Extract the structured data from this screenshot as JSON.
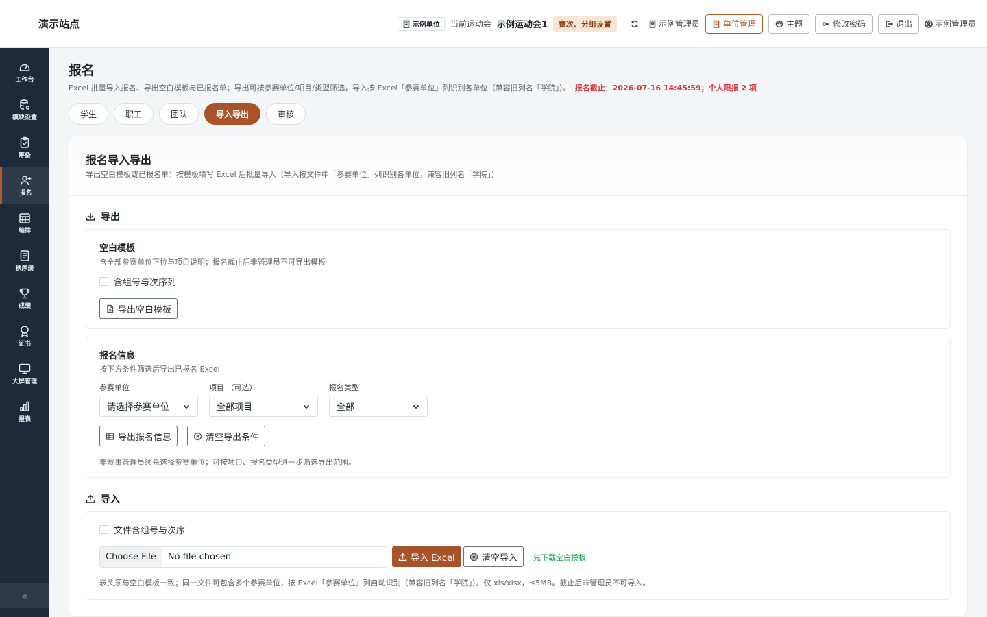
{
  "header": {
    "site_title": "演示站点",
    "unit_tag": "示例单位",
    "current_meet_label": "当前运动会",
    "current_meet": "示例运动会1",
    "round_group_tag": "赛次、分组设置",
    "admin_role": "示例管理员",
    "unit_manage": "单位管理",
    "theme": "主题",
    "change_password": "修改密码",
    "logout": "退出",
    "user": "示例管理员",
    "accent_color": "#b65a28"
  },
  "sidebar": {
    "items": [
      {
        "label": "工作台",
        "icon": "dashboard-icon"
      },
      {
        "label": "模块设置",
        "icon": "database-settings-icon"
      },
      {
        "label": "筹备",
        "icon": "clipboard-icon"
      },
      {
        "label": "报名",
        "icon": "user-add-icon"
      },
      {
        "label": "编排",
        "icon": "calendar-grid-icon"
      },
      {
        "label": "秩序册",
        "icon": "book-list-icon"
      },
      {
        "label": "成绩",
        "icon": "trophy-icon"
      },
      {
        "label": "证书",
        "icon": "award-icon"
      },
      {
        "label": "大屏管理",
        "icon": "monitor-icon"
      },
      {
        "label": "报表",
        "icon": "bar-chart-icon"
      }
    ],
    "active_index": 3,
    "collapse_glyph": "«"
  },
  "page": {
    "title": "报名",
    "description": "Excel 批量导入报名、导出空白模板与已报名单；导出可按参赛单位/项目/类型筛选，导入按 Excel「参赛单位」列识别各单位（兼容旧列名「学院」）。",
    "deadline": "报名截止：2026-07-16 14:45:59；个人限报 2 项",
    "tabs": [
      "学生",
      "职工",
      "团队",
      "导入导出",
      "审核"
    ],
    "active_tab": 3
  },
  "panel": {
    "title": "报名导入导出",
    "subtitle": "导出空白模板或已报名单；按模板填写 Excel 后批量导入（导入按文件中「参赛单位」列识别各单位，兼容旧列名「学院」）",
    "export_section": "导出",
    "blank_template": {
      "title": "空白模板",
      "subtitle": "含全部参赛单位下拉与项目说明；报名截止后非管理员不可导出模板",
      "checkbox_label": "含组号与次序列",
      "button": "导出空白模板"
    },
    "registration_info": {
      "title": "报名信息",
      "subtitle": "按下方条件筛选后导出已报名 Excel",
      "unit_label": "参赛单位",
      "unit_value": "请选择参赛单位",
      "event_label": "项目 （可选）",
      "event_value": "全部项目",
      "type_label": "报名类型",
      "type_value": "全部",
      "export_button": "导出报名信息",
      "clear_button": "清空导出条件",
      "hint": "非赛事管理员须先选择参赛单位；可按项目、报名类型进一步筛选导出范围。"
    },
    "import_section": "导入",
    "import": {
      "checkbox_label": "文件含组号与次序",
      "file_button": "Choose File",
      "file_status": "No file chosen",
      "import_button": "导入 Excel",
      "clear_button": "清空导入",
      "download_link": "先下载空白模板",
      "hint": "表头须与空白模板一致；同一文件可包含多个参赛单位，按 Excel「参赛单位」列自动识别（兼容旧列名「学院」）。仅 xls/xlsx，≤5MB。截止后非管理员不可导入。"
    }
  }
}
